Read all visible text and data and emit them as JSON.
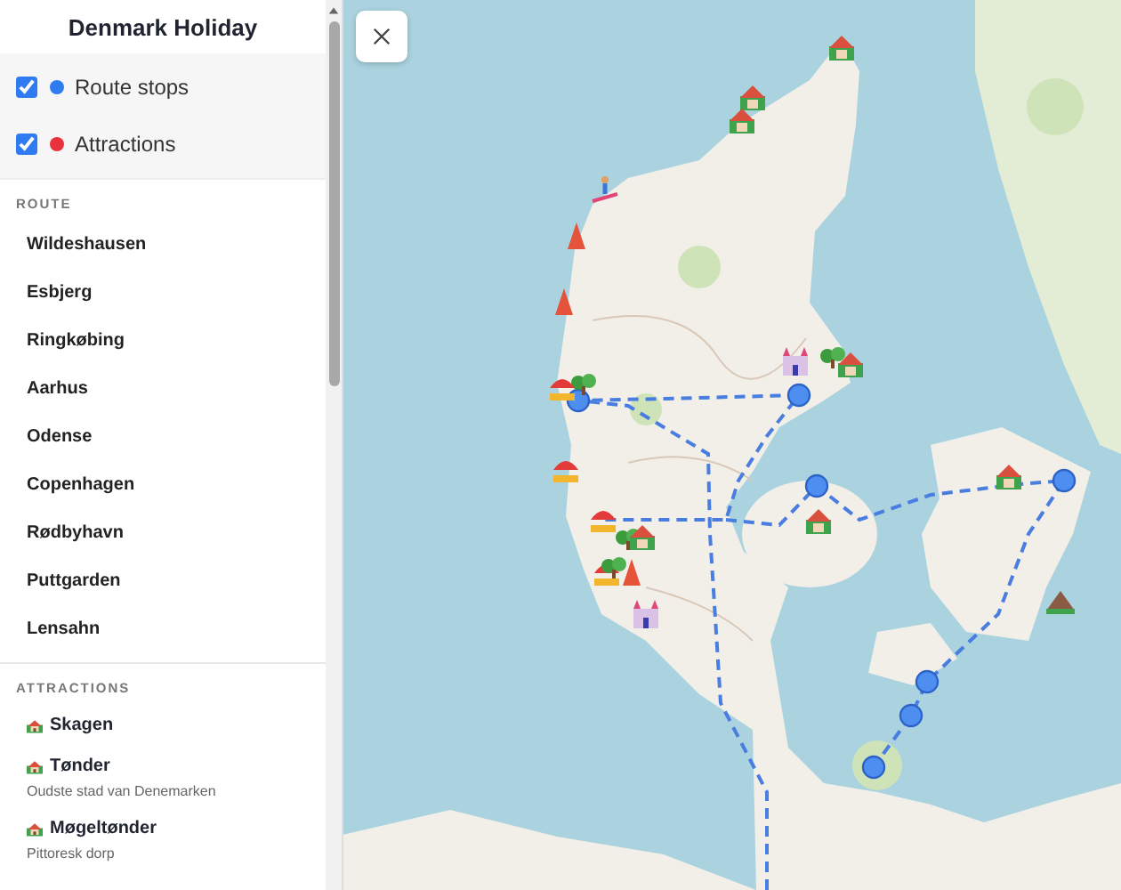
{
  "title": "Denmark Holiday",
  "layers": [
    {
      "label": "Route stops",
      "checked": true,
      "color": "#2f7bf0"
    },
    {
      "label": "Attractions",
      "checked": true,
      "color": "#e8333f"
    }
  ],
  "route": {
    "heading": "ROUTE",
    "stops": [
      {
        "name": "Wildeshausen"
      },
      {
        "name": "Esbjerg"
      },
      {
        "name": "Ringkøbing"
      },
      {
        "name": "Aarhus"
      },
      {
        "name": "Odense"
      },
      {
        "name": "Copenhagen"
      },
      {
        "name": "Rødbyhavn"
      },
      {
        "name": "Puttgarden"
      },
      {
        "name": "Lensahn"
      }
    ]
  },
  "attractions": {
    "heading": "ATTRACTIONS",
    "items": [
      {
        "name": "Skagen"
      },
      {
        "name": "Tønder",
        "description": "Oudste stad van Denemarken"
      },
      {
        "name": "Møgeltønder",
        "description": "Pittoresk dorp"
      }
    ]
  }
}
